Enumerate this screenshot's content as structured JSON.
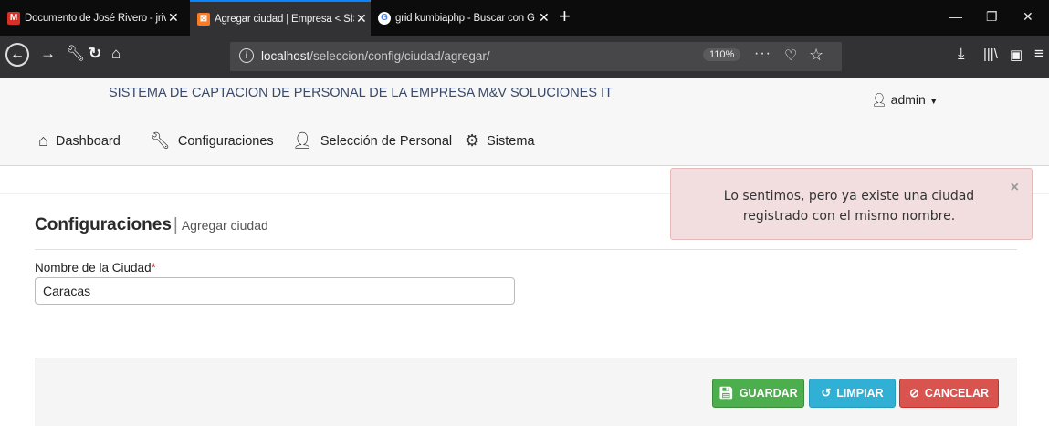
{
  "browser": {
    "tabs": [
      {
        "title": "Documento de José Rivero - jriv",
        "icon": "gmail-icon",
        "color": "#d93025",
        "glyph": "M"
      },
      {
        "title": "Agregar ciudad | Empresa < SIST",
        "icon": "xampp-icon",
        "color": "#fb7a24",
        "glyph": "⊠"
      },
      {
        "title": "grid kumbiaphp - Buscar con G",
        "icon": "google-icon",
        "color": "#4285f4",
        "glyph": "G"
      }
    ],
    "url_host": "localhost",
    "url_path": "/seleccion/config/ciudad/agregar/",
    "zoom": "110%"
  },
  "header": {
    "brand": "SISTEMA DE CAPTACION DE PERSONAL DE LA EMPRESA M&V SOLUCIONES IT",
    "user": "admin"
  },
  "menu": {
    "dashboard": "Dashboard",
    "config": "Configuraciones",
    "seleccion": "Selección de Personal",
    "sistema": "Sistema"
  },
  "page": {
    "title": "Configuraciones",
    "subtitle": "Agregar ciudad"
  },
  "form": {
    "label": "Nombre de la Ciudad",
    "required_mark": "*",
    "value": "Caracas"
  },
  "buttons": {
    "save": "GUARDAR",
    "clear": "LIMPIAR",
    "cancel": "CANCELAR"
  },
  "alert": {
    "message": "Lo sentimos, pero ya existe una ciudad registrado con el mismo nombre.",
    "close": "×"
  },
  "colors": {
    "save": "#4cae4c",
    "clear": "#31b0d5",
    "cancel": "#d9534f",
    "alert_bg": "#f2dede",
    "active_tab_accent": "#0a84ff"
  }
}
